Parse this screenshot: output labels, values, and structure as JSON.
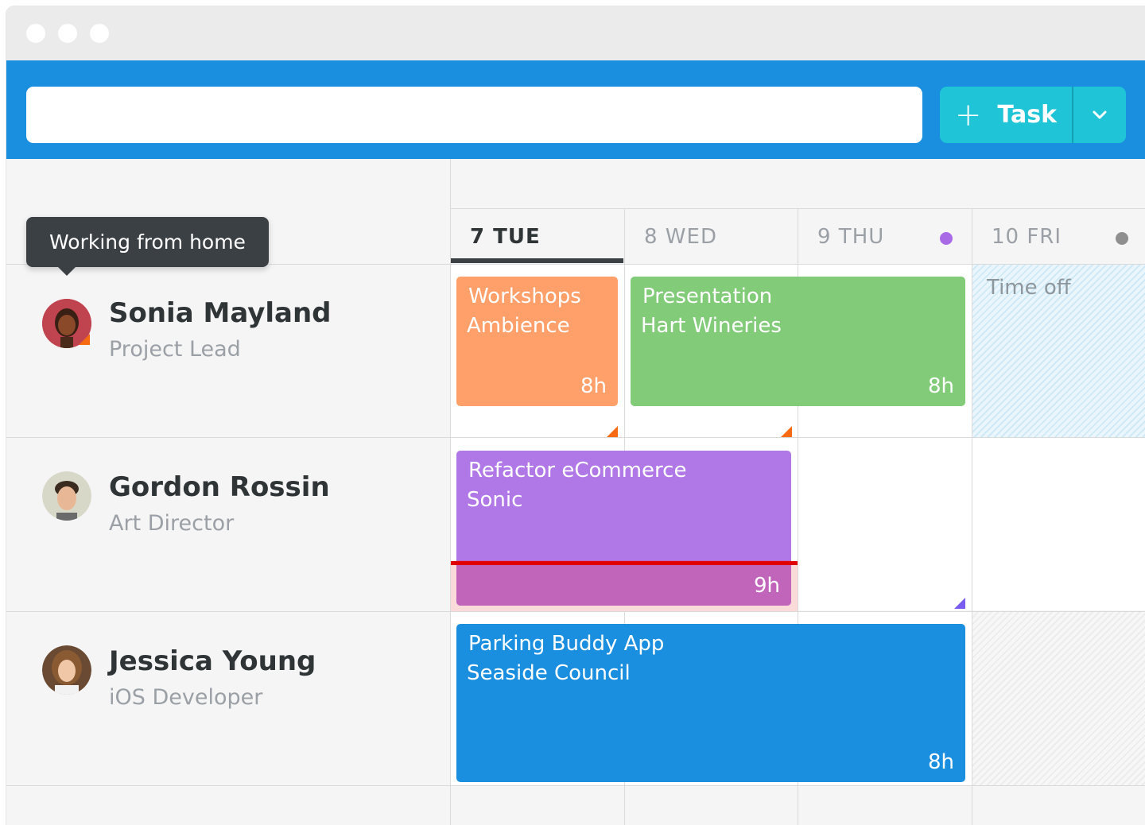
{
  "toolbar": {
    "search_value": "",
    "task_button_label": "Task",
    "task_button_icon": "plus-icon",
    "dropdown_icon": "chevron-down-icon"
  },
  "days": [
    {
      "label": "7 TUE",
      "active": true
    },
    {
      "label": "8 WED",
      "active": false
    },
    {
      "label": "9 THU",
      "active": false,
      "dot_color": "#a96ae6"
    },
    {
      "label": "10 FRI",
      "active": false,
      "dot_color": "#8f8f8f"
    }
  ],
  "tooltip": {
    "text": "Working from home"
  },
  "people": [
    {
      "name": "Sonia Mayland",
      "role": "Project Lead"
    },
    {
      "name": "Gordon Rossin",
      "role": "Art Director"
    },
    {
      "name": "Jessica Young",
      "role": "iOS Developer"
    }
  ],
  "tasks": [
    {
      "title": "Workshops",
      "client": "Ambience",
      "hours": "8h",
      "color": "#ff9f6a"
    },
    {
      "title": "Presentation",
      "client": "Hart Wineries",
      "hours": "8h",
      "color": "#82cb79"
    },
    {
      "title": "Refactor eCommerce",
      "client": "Sonic",
      "hours": "9h",
      "color": "#b077e6",
      "overtime_color": "#c165ba",
      "overtime_line_color": "#e00000"
    },
    {
      "title": "Parking Buddy App",
      "client": "Seaside Council",
      "hours": "8h",
      "color": "#1b8fdf"
    }
  ],
  "time_off": {
    "label": "Time off"
  },
  "colors": {
    "brand_blue": "#1b8fdf",
    "task_button": "#1fc4d6",
    "corner_orange": "#f76a14",
    "corner_purple": "#7b5cf0"
  }
}
